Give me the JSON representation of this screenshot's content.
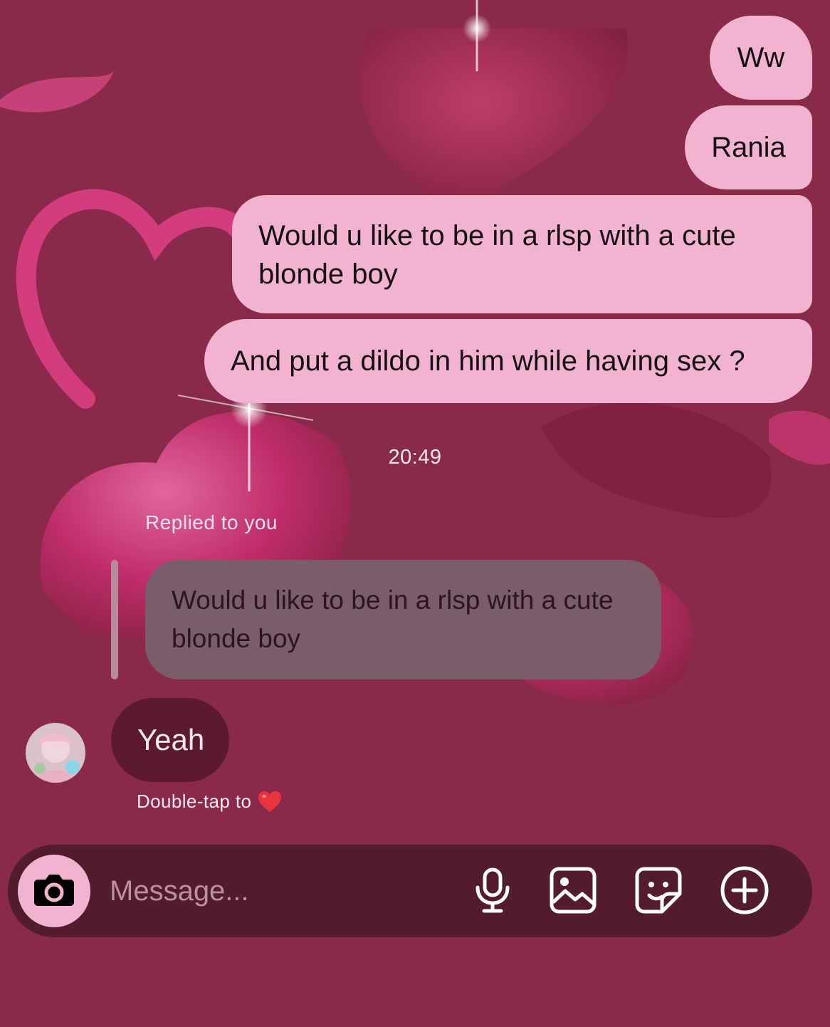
{
  "messages_out": [
    {
      "text": "Ww"
    },
    {
      "text": "Rania"
    },
    {
      "text": "Would u like to be in a rlsp with a cute blonde boy"
    },
    {
      "text": "And put a dildo in him while having sex ?"
    }
  ],
  "timestamp": "20:49",
  "reply": {
    "label": "Replied to you",
    "quoted_text": "Would u like to be in a rlsp with a cute blonde boy"
  },
  "message_in": {
    "text": "Yeah",
    "avatar_icon": "profile-avatar"
  },
  "hint": {
    "text": "Double-tap to",
    "emoji_icon": "red-heart-icon"
  },
  "composer": {
    "placeholder": "Message...",
    "icons": [
      "camera-icon",
      "microphone-icon",
      "gallery-icon",
      "sticker-icon",
      "plus-icon"
    ]
  },
  "colors": {
    "background": "#8a2a4a",
    "outgoing_bubble": "#f2b3d1",
    "incoming_bubble": "#5c1a30",
    "reply_bubble": "#7a5c6a",
    "composer": "#531c2e"
  }
}
